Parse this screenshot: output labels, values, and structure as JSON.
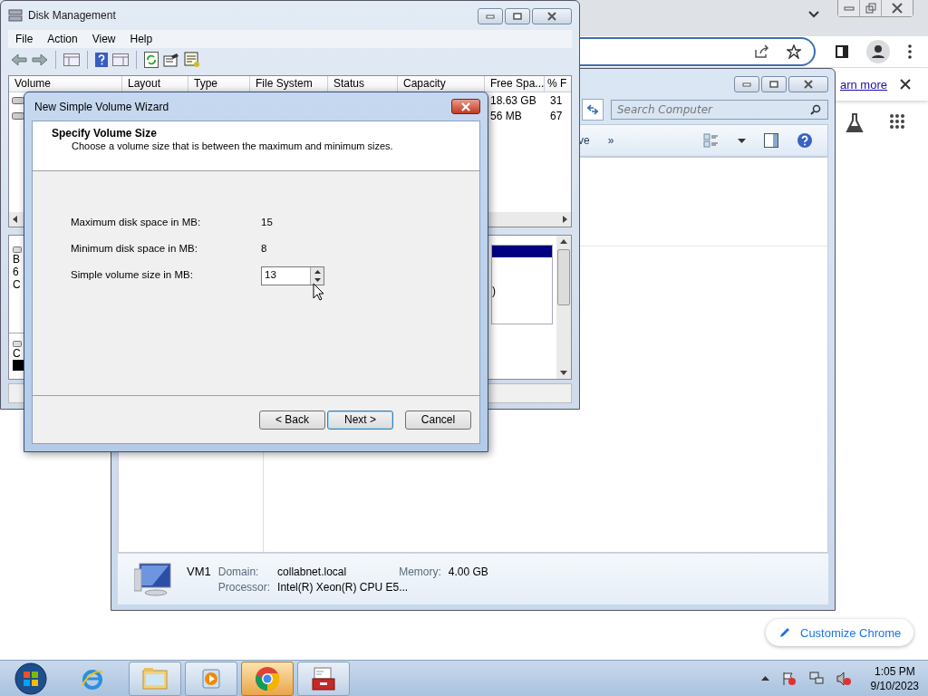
{
  "chrome": {
    "learn_more": "arn more",
    "customize_button": "Customize Chrome"
  },
  "explorer": {
    "search": {
      "placeholder": "Search Computer"
    },
    "toolbar_items": [
      "ve",
      "»"
    ],
    "details": {
      "name": "VM1",
      "domain_label": "Domain:",
      "domain": "collabnet.local",
      "memory_label": "Memory:",
      "memory": "4.00 GB",
      "processor_label": "Processor:",
      "processor": "Intel(R) Xeon(R) CPU E5..."
    }
  },
  "disk_management": {
    "title": "Disk Management",
    "menu": [
      "File",
      "Action",
      "View",
      "Help"
    ],
    "columns": [
      "Volume",
      "Layout",
      "Type",
      "File System",
      "Status",
      "Capacity",
      "Free Spa...",
      "% F"
    ],
    "rows": [
      {
        "free_space": "18.63 GB",
        "percent_free": "31"
      },
      {
        "free_space": "56 MB",
        "percent_free": "67"
      }
    ],
    "disk_fragments": [
      "B",
      "6",
      "C"
    ],
    "disk2_fragment": "C",
    "partition_fragment": ")"
  },
  "wizard": {
    "title": "New Simple Volume Wizard",
    "heading": "Specify Volume Size",
    "subtitle": "Choose a volume size that is between the maximum and minimum sizes.",
    "fields": [
      {
        "label": "Maximum disk space in MB:",
        "value": "15",
        "kind": "text"
      },
      {
        "label": "Minimum disk space in MB:",
        "value": "8",
        "kind": "text"
      },
      {
        "label": "Simple volume size in MB:",
        "value": "13",
        "kind": "spin"
      }
    ],
    "buttons": [
      {
        "label": "< Back",
        "default": false
      },
      {
        "label": "Next >",
        "default": true
      },
      {
        "label": "Cancel",
        "default": false
      }
    ]
  },
  "taskbar": {
    "apps": [
      {
        "kind": "ie",
        "selected": false
      },
      {
        "kind": "explorer",
        "selected": false
      },
      {
        "kind": "media",
        "selected": false
      },
      {
        "kind": "chrome",
        "selected": true
      },
      {
        "kind": "toolbox",
        "selected": false
      }
    ],
    "time": "1:05 PM",
    "date": "9/10/2023"
  }
}
